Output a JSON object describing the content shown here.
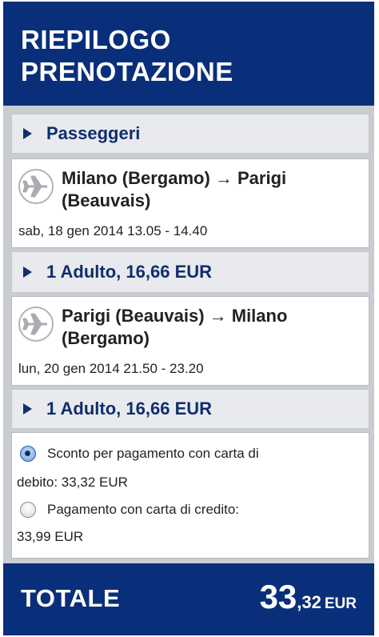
{
  "header": {
    "title": "RIEPILOGO PRENOTAZIONE"
  },
  "passengers": {
    "label": "Passeggeri"
  },
  "flights": [
    {
      "route": "Milano (Bergamo) → Parigi (Beauvais)",
      "datetime": "sab, 18 gen 2014 13.05 - 14.40",
      "fare": "1 Adulto, 16,66 EUR"
    },
    {
      "route": "Parigi (Beauvais) → Milano (Bergamo)",
      "datetime": "lun, 20 gen 2014 21.50 - 23.20",
      "fare": "1 Adulto, 16,66 EUR"
    }
  ],
  "payment_options": [
    {
      "line1": "Sconto per pagamento con carta di",
      "line2": "debito: 33,32 EUR",
      "selected": true
    },
    {
      "line1": "Pagamento con carta di credito:",
      "line2": "33,99 EUR",
      "selected": false
    }
  ],
  "total": {
    "label": "TOTALE",
    "integer": "33",
    "decimal": ",32",
    "currency": "EUR"
  },
  "colors": {
    "brand": "#0a2f7a",
    "bar_text": "#102e6e",
    "radio_selected": "#2a5fb8"
  }
}
